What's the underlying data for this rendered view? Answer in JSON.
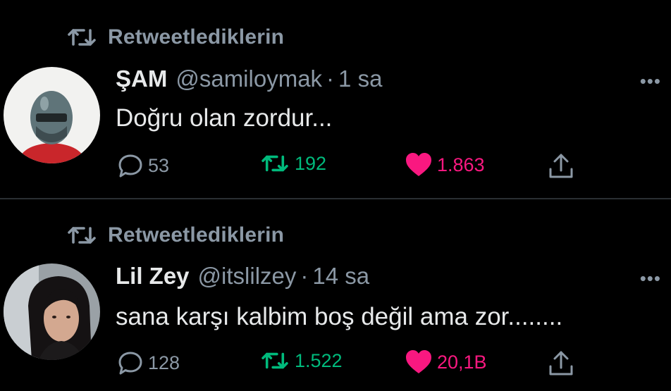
{
  "tweets": [
    {
      "retweet_label": "Retweetlediklerin",
      "name": "ŞAM",
      "handle": "@samiloymak",
      "separator": "·",
      "time": "1 sa",
      "text": "Doğru olan zordur...",
      "replies": "53",
      "retweets": "192",
      "likes": "1.863",
      "more": "•••"
    },
    {
      "retweet_label": "Retweetlediklerin",
      "name": "Lil Zey",
      "handle": "@itslilzey",
      "separator": "·",
      "time": "14 sa",
      "text": "sana karşı kalbim boş değil ama zor........",
      "replies": "128",
      "retweets": "1.522",
      "likes": "20,1B",
      "more": "•••"
    }
  ],
  "icons": {
    "retweet_context": "retweet-icon",
    "reply": "reply-icon",
    "retweet": "retweet-icon",
    "like": "heart-icon",
    "share": "share-icon",
    "more": "more-icon"
  },
  "colors": {
    "background": "#000000",
    "text": "#e7e9ea",
    "secondary": "#8b98a5",
    "retweet_green": "#00ba7c",
    "like_pink": "#f91880"
  }
}
